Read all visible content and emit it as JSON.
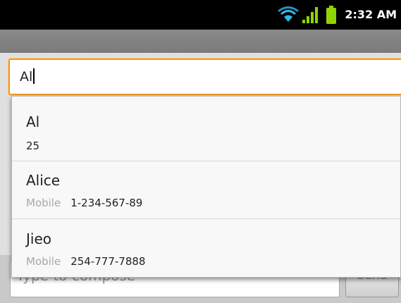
{
  "status_bar": {
    "time": "2:32 AM",
    "icons": [
      "wifi-icon",
      "signal-icon",
      "battery-icon"
    ],
    "accent": "#33b5e5",
    "signal_color": "#8fd400"
  },
  "recipient_field": {
    "value": "Al",
    "focus_color": "#ef9a27"
  },
  "suggestions": [
    {
      "name": "Al",
      "type": "",
      "number": "25"
    },
    {
      "name": "Alice",
      "type": "Mobile",
      "number": "1-234-567-89"
    },
    {
      "name": "Jieo",
      "type": "Mobile",
      "number": "254-777-7888"
    }
  ],
  "compose": {
    "placeholder": "Type to compose",
    "send_label": "Send"
  }
}
